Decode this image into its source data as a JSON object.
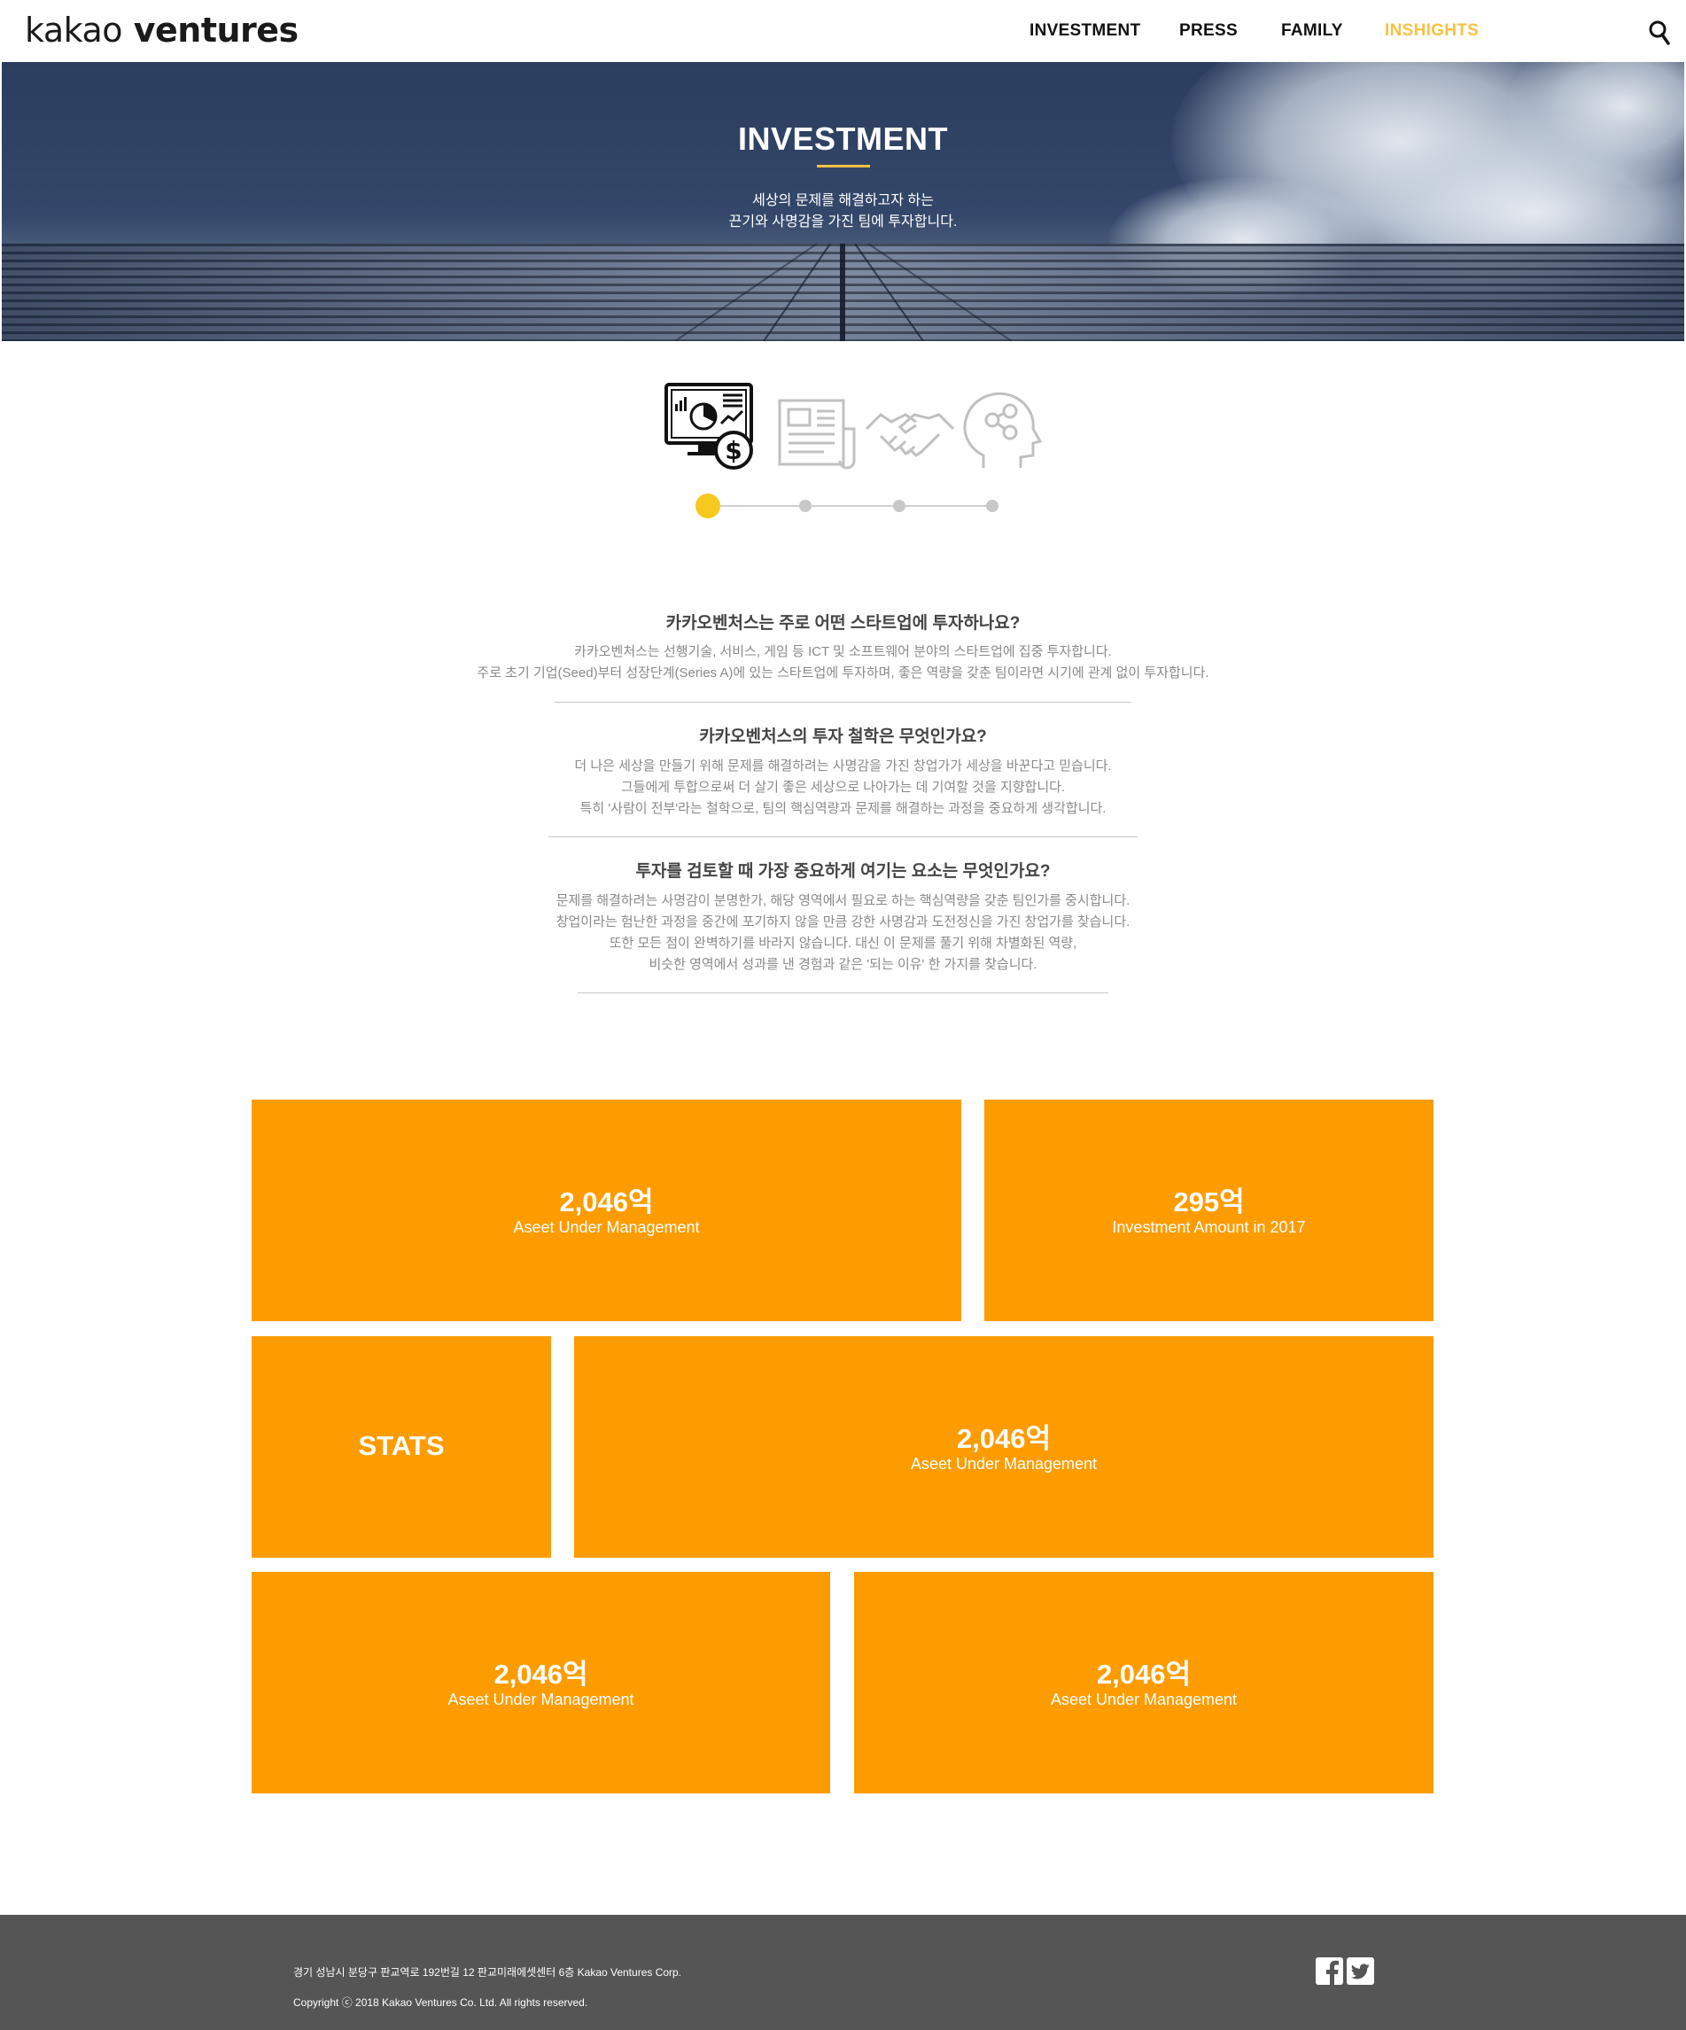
{
  "header": {
    "logo_light": "kakao",
    "logo_bold": " ventures",
    "nav": [
      "INVESTMENT",
      "PRESS",
      "FAMILY",
      "INSHIGHTS"
    ],
    "active_nav_color": "#f6c244",
    "search_icon": "search-icon"
  },
  "hero": {
    "title": "INVESTMENT",
    "subtitle_line1": "세상의 문제를 해결하고자 하는",
    "subtitle_line2": "끈기와 사명감을 가진 팀에 투자합니다."
  },
  "steps": {
    "icons": [
      "monitor-chart-dollar-icon",
      "newspaper-icon",
      "handshake-icon",
      "head-network-icon"
    ],
    "active_index": 0,
    "active_color": "#f6c91c"
  },
  "faq": [
    {
      "question": "카카오벤처스는 주로 어떤 스타트업에 투자하나요?",
      "answer": [
        "카카오벤처스는 선행기술, 서비스, 게임 등 ICT 및 소프트웨어 분야의 스타트업에 집중 투자합니다.",
        "주로 초기 기업(Seed)부터 성장단계(Series A)에 있는 스타트업에 투자하며, 좋은 역량을 갖춘 팀이라면 시기에 관계 없이 투자합니다."
      ]
    },
    {
      "question": "카카오벤처스의 투자 철학은 무엇인가요?",
      "answer": [
        "더 나은 세상을 만들기 위해 문제를 해결하려는 사명감을 가진 창업가가 세상을 바꾼다고 믿습니다.",
        "그들에게 투합으로써 더 살기 좋은 세상으로 나아가는 데 기여할 것을 지향합니다.",
        "특히 '사람이 전부'라는 철학으로, 팀의 핵심역량과 문제를 해결하는 과정을 중요하게 생각합니다."
      ]
    },
    {
      "question": "투자를 검토할 때 가장 중요하게 여기는 요소는 무엇인가요?",
      "answer": [
        "문제를 해결하려는 사명감이 분명한가, 해당 영역에서 필요로 하는 핵심역량을 갖춘 팀인가를 중시합니다.",
        "창업이라는 험난한 과정을 중간에 포기하지 않을 만큼 강한 사명감과 도전정신을 가진 창업가를 찾습니다.",
        "또한 모든 점이 완벽하기를 바라지 않습니다. 대신 이 문제를 풀기 위해 차별화된 역량,",
        "비슷한 영역에서 성과를 낸 경험과 같은 '되는 이유' 한 가지를 찾습니다."
      ]
    }
  ],
  "stats": {
    "accent_color": "#fd9c00",
    "tiles": [
      {
        "value": "2,046억",
        "label": "Aseet Under Management"
      },
      {
        "value": "295억",
        "label": "Investment Amount in 2017"
      },
      {
        "value": "STATS",
        "label": ""
      },
      {
        "value": "2,046억",
        "label": "Aseet Under Management"
      },
      {
        "value": "2,046억",
        "label": "Aseet Under Management"
      },
      {
        "value": "2,046억",
        "label": "Aseet Under Management"
      }
    ]
  },
  "footer": {
    "address": "경기 성남시 분당구 판교역로 192번길 12 판교미래에셋센터 6층 Kakao Ventures Corp.",
    "copyright": "Copyright ⓒ 2018 Kakao Ventures Co. Ltd. All rights reserved.",
    "social": [
      "facebook-icon",
      "twitter-icon"
    ]
  }
}
